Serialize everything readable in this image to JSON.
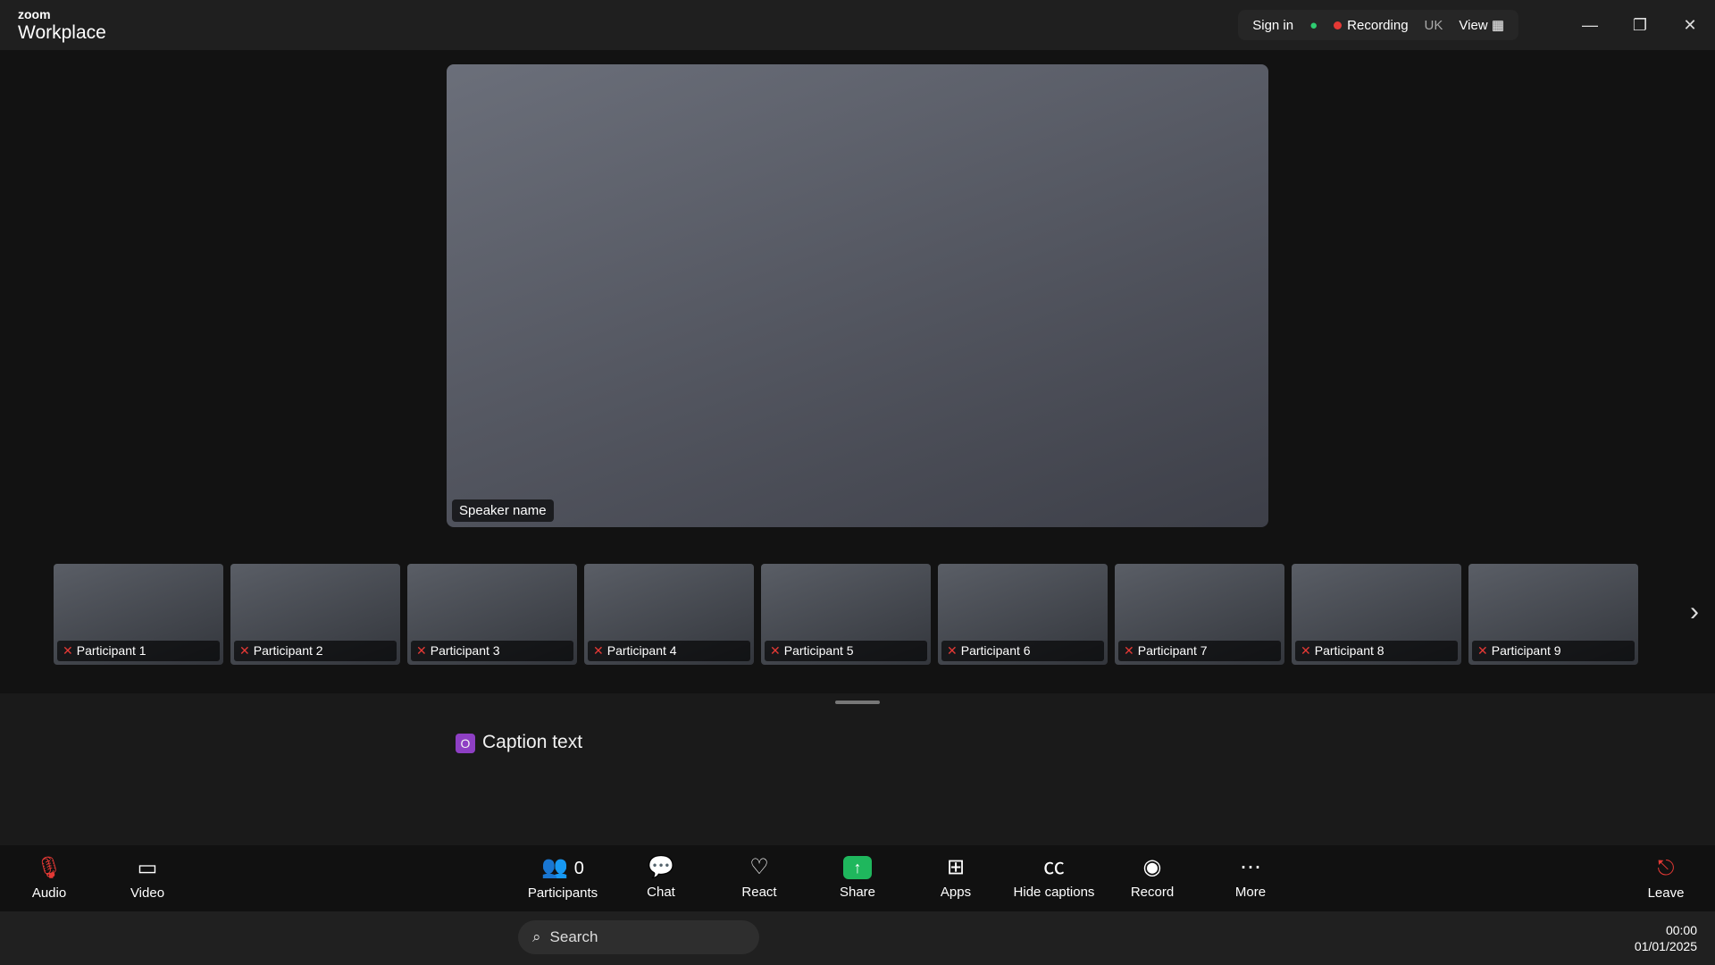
{
  "titlebar": {
    "brand_top": "zoom",
    "brand_bottom": "Workplace",
    "sign_in": "Sign in",
    "recording": "Recording",
    "region": "UK",
    "view": "View"
  },
  "main": {
    "name": "Speaker name"
  },
  "participants": [
    {
      "name": "Participant 1"
    },
    {
      "name": "Participant 2"
    },
    {
      "name": "Participant 3"
    },
    {
      "name": "Participant 4"
    },
    {
      "name": "Participant 5"
    },
    {
      "name": "Participant 6"
    },
    {
      "name": "Participant 7"
    },
    {
      "name": "Participant 8"
    },
    {
      "name": "Participant 9"
    }
  ],
  "captions": {
    "badge": "O",
    "text": "Caption text"
  },
  "toolbar": {
    "audio": "Audio",
    "video": "Video",
    "participants": "Participants",
    "participants_count": "0",
    "chat": "Chat",
    "react": "React",
    "share": "Share",
    "apps": "Apps",
    "captions": "Hide captions",
    "record": "Record",
    "more": "More",
    "leave": "Leave"
  },
  "taskbar": {
    "temp": "",
    "weather": "",
    "search": "Search",
    "lang": "",
    "time": "00:00",
    "date": "01/01/2025"
  }
}
